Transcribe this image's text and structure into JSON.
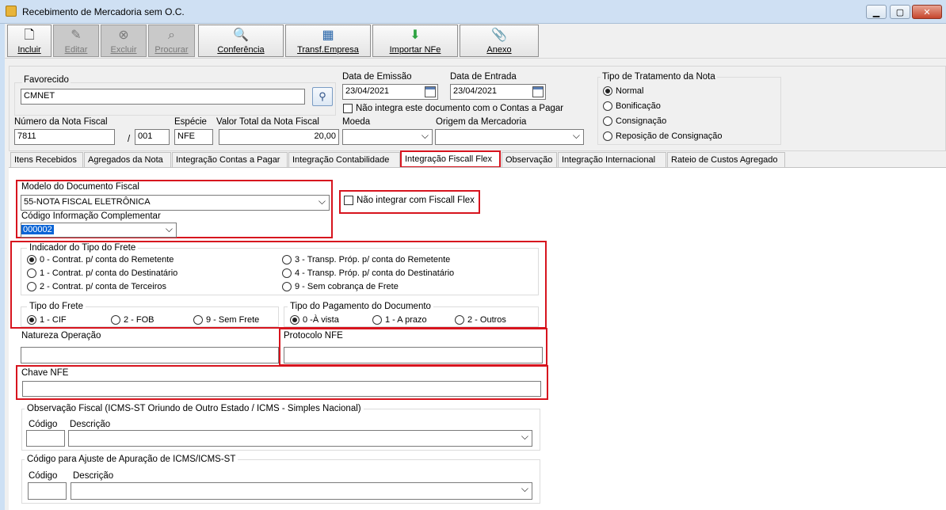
{
  "window": {
    "title": "Recebimento de Mercadoria sem O.C."
  },
  "toolbar": {
    "incluir": "Incluir",
    "editar": "Editar",
    "excluir": "Excluir",
    "procurar": "Procurar",
    "conferencia": "Conferência",
    "transf": "Transf.Empresa",
    "importar": "Importar NFe",
    "anexo": "Anexo"
  },
  "header": {
    "favorecido_label": "Favorecido",
    "favorecido_value": "CMNET",
    "data_emissao_label": "Data de Emissão",
    "data_emissao_value": "23/04/2021",
    "data_entrada_label": "Data de Entrada",
    "data_entrada_value": "23/04/2021",
    "nao_integra_label": "Não integra este documento com o Contas a Pagar",
    "tipo_trat_label": "Tipo de Tratamento da Nota",
    "tipo_trat_options": [
      "Normal",
      "Bonificação",
      "Consignação",
      "Reposição de Consignação"
    ],
    "numero_label": "Número da Nota Fiscal",
    "numero_value": "7811",
    "serie_sep": "/",
    "serie_value": "001",
    "especie_label": "Espécie",
    "especie_value": "NFE",
    "valor_label": "Valor Total da Nota Fiscal",
    "valor_value": "20,00",
    "moeda_label": "Moeda",
    "moeda_value": "",
    "origem_label": "Origem da Mercadoria",
    "origem_value": ""
  },
  "tabs": [
    "Itens Recebidos",
    "Agregados da Nota",
    "Integração Contas a Pagar",
    "Integração Contabilidade",
    "Integração Fiscall Flex",
    "Observação",
    "Integração Internacional",
    "Rateio de Custos Agregado"
  ],
  "fiscal": {
    "modelo_label": "Modelo do Documento Fiscal",
    "modelo_value": "55-NOTA FISCAL ELETRÔNICA",
    "codigo_info_label": "Código Informação Complementar",
    "codigo_info_value": "000002",
    "nao_integrar_label": "Não integrar com Fiscall Flex",
    "frete_ind_label": "Indicador do Tipo do Frete",
    "frete_ind_options": [
      "0 - Contrat. p/ conta do Remetente",
      "1 - Contrat. p/ conta do Destinatário",
      "2 - Contrat. p/ conta de Terceiros",
      "3 - Transp. Próp. p/ conta do Remetente",
      "4 - Transp. Próp. p/ conta do Destinatário",
      "9 - Sem cobrança de Frete"
    ],
    "tipo_frete_label": "Tipo do Frete",
    "tipo_frete_options": [
      "1 - CIF",
      "2 - FOB",
      "9 - Sem Frete"
    ],
    "tipo_pag_label": "Tipo do Pagamento do Documento",
    "tipo_pag_options": [
      "0 -À vista",
      "1 - A prazo",
      "2 - Outros"
    ],
    "natureza_label": "Natureza Operação",
    "natureza_value": "",
    "protocolo_label": "Protocolo NFE",
    "protocolo_value": "",
    "chave_label": "Chave NFE",
    "chave_value": "",
    "obs_label": "Observação Fiscal (ICMS-ST Oriundo de Outro Estado / ICMS - Simples Nacional)",
    "codigo_label": "Código",
    "descricao_label": "Descrição",
    "ajuste_label": "Código para Ajuste de Apuração de ICMS/ICMS-ST"
  }
}
